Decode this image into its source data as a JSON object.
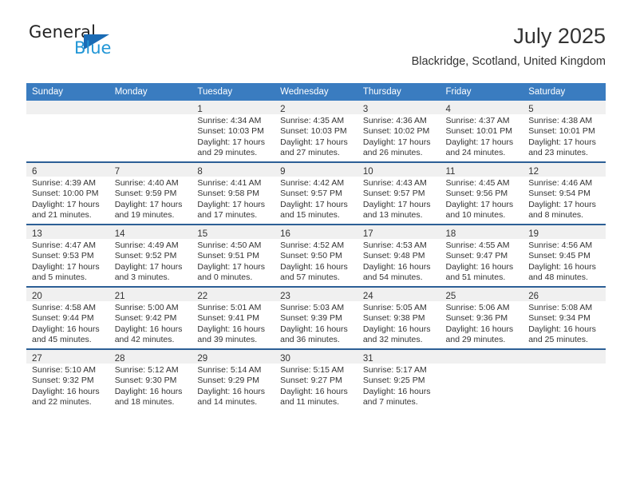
{
  "brand": {
    "name_top": "General",
    "name_bottom": "Blue",
    "triangle_icon": "triangle-icon",
    "colors": {
      "blue": "#1a6bb5",
      "light_blue": "#2196d6",
      "text": "#222222"
    }
  },
  "header": {
    "title": "July 2025",
    "location": "Blackridge, Scotland, United Kingdom"
  },
  "calendar": {
    "header_bg": "#3a7cc0",
    "row_divider": "#2c5f96",
    "daynum_bg": "#f0f0f0",
    "weekdays": [
      "Sunday",
      "Monday",
      "Tuesday",
      "Wednesday",
      "Thursday",
      "Friday",
      "Saturday"
    ],
    "weeks": [
      [
        {
          "day": "",
          "lines": []
        },
        {
          "day": "",
          "lines": []
        },
        {
          "day": "1",
          "lines": [
            "Sunrise: 4:34 AM",
            "Sunset: 10:03 PM",
            "Daylight: 17 hours",
            "and 29 minutes."
          ]
        },
        {
          "day": "2",
          "lines": [
            "Sunrise: 4:35 AM",
            "Sunset: 10:03 PM",
            "Daylight: 17 hours",
            "and 27 minutes."
          ]
        },
        {
          "day": "3",
          "lines": [
            "Sunrise: 4:36 AM",
            "Sunset: 10:02 PM",
            "Daylight: 17 hours",
            "and 26 minutes."
          ]
        },
        {
          "day": "4",
          "lines": [
            "Sunrise: 4:37 AM",
            "Sunset: 10:01 PM",
            "Daylight: 17 hours",
            "and 24 minutes."
          ]
        },
        {
          "day": "5",
          "lines": [
            "Sunrise: 4:38 AM",
            "Sunset: 10:01 PM",
            "Daylight: 17 hours",
            "and 23 minutes."
          ]
        }
      ],
      [
        {
          "day": "6",
          "lines": [
            "Sunrise: 4:39 AM",
            "Sunset: 10:00 PM",
            "Daylight: 17 hours",
            "and 21 minutes."
          ]
        },
        {
          "day": "7",
          "lines": [
            "Sunrise: 4:40 AM",
            "Sunset: 9:59 PM",
            "Daylight: 17 hours",
            "and 19 minutes."
          ]
        },
        {
          "day": "8",
          "lines": [
            "Sunrise: 4:41 AM",
            "Sunset: 9:58 PM",
            "Daylight: 17 hours",
            "and 17 minutes."
          ]
        },
        {
          "day": "9",
          "lines": [
            "Sunrise: 4:42 AM",
            "Sunset: 9:57 PM",
            "Daylight: 17 hours",
            "and 15 minutes."
          ]
        },
        {
          "day": "10",
          "lines": [
            "Sunrise: 4:43 AM",
            "Sunset: 9:57 PM",
            "Daylight: 17 hours",
            "and 13 minutes."
          ]
        },
        {
          "day": "11",
          "lines": [
            "Sunrise: 4:45 AM",
            "Sunset: 9:56 PM",
            "Daylight: 17 hours",
            "and 10 minutes."
          ]
        },
        {
          "day": "12",
          "lines": [
            "Sunrise: 4:46 AM",
            "Sunset: 9:54 PM",
            "Daylight: 17 hours",
            "and 8 minutes."
          ]
        }
      ],
      [
        {
          "day": "13",
          "lines": [
            "Sunrise: 4:47 AM",
            "Sunset: 9:53 PM",
            "Daylight: 17 hours",
            "and 5 minutes."
          ]
        },
        {
          "day": "14",
          "lines": [
            "Sunrise: 4:49 AM",
            "Sunset: 9:52 PM",
            "Daylight: 17 hours",
            "and 3 minutes."
          ]
        },
        {
          "day": "15",
          "lines": [
            "Sunrise: 4:50 AM",
            "Sunset: 9:51 PM",
            "Daylight: 17 hours",
            "and 0 minutes."
          ]
        },
        {
          "day": "16",
          "lines": [
            "Sunrise: 4:52 AM",
            "Sunset: 9:50 PM",
            "Daylight: 16 hours",
            "and 57 minutes."
          ]
        },
        {
          "day": "17",
          "lines": [
            "Sunrise: 4:53 AM",
            "Sunset: 9:48 PM",
            "Daylight: 16 hours",
            "and 54 minutes."
          ]
        },
        {
          "day": "18",
          "lines": [
            "Sunrise: 4:55 AM",
            "Sunset: 9:47 PM",
            "Daylight: 16 hours",
            "and 51 minutes."
          ]
        },
        {
          "day": "19",
          "lines": [
            "Sunrise: 4:56 AM",
            "Sunset: 9:45 PM",
            "Daylight: 16 hours",
            "and 48 minutes."
          ]
        }
      ],
      [
        {
          "day": "20",
          "lines": [
            "Sunrise: 4:58 AM",
            "Sunset: 9:44 PM",
            "Daylight: 16 hours",
            "and 45 minutes."
          ]
        },
        {
          "day": "21",
          "lines": [
            "Sunrise: 5:00 AM",
            "Sunset: 9:42 PM",
            "Daylight: 16 hours",
            "and 42 minutes."
          ]
        },
        {
          "day": "22",
          "lines": [
            "Sunrise: 5:01 AM",
            "Sunset: 9:41 PM",
            "Daylight: 16 hours",
            "and 39 minutes."
          ]
        },
        {
          "day": "23",
          "lines": [
            "Sunrise: 5:03 AM",
            "Sunset: 9:39 PM",
            "Daylight: 16 hours",
            "and 36 minutes."
          ]
        },
        {
          "day": "24",
          "lines": [
            "Sunrise: 5:05 AM",
            "Sunset: 9:38 PM",
            "Daylight: 16 hours",
            "and 32 minutes."
          ]
        },
        {
          "day": "25",
          "lines": [
            "Sunrise: 5:06 AM",
            "Sunset: 9:36 PM",
            "Daylight: 16 hours",
            "and 29 minutes."
          ]
        },
        {
          "day": "26",
          "lines": [
            "Sunrise: 5:08 AM",
            "Sunset: 9:34 PM",
            "Daylight: 16 hours",
            "and 25 minutes."
          ]
        }
      ],
      [
        {
          "day": "27",
          "lines": [
            "Sunrise: 5:10 AM",
            "Sunset: 9:32 PM",
            "Daylight: 16 hours",
            "and 22 minutes."
          ]
        },
        {
          "day": "28",
          "lines": [
            "Sunrise: 5:12 AM",
            "Sunset: 9:30 PM",
            "Daylight: 16 hours",
            "and 18 minutes."
          ]
        },
        {
          "day": "29",
          "lines": [
            "Sunrise: 5:14 AM",
            "Sunset: 9:29 PM",
            "Daylight: 16 hours",
            "and 14 minutes."
          ]
        },
        {
          "day": "30",
          "lines": [
            "Sunrise: 5:15 AM",
            "Sunset: 9:27 PM",
            "Daylight: 16 hours",
            "and 11 minutes."
          ]
        },
        {
          "day": "31",
          "lines": [
            "Sunrise: 5:17 AM",
            "Sunset: 9:25 PM",
            "Daylight: 16 hours",
            "and 7 minutes."
          ]
        },
        {
          "day": "",
          "lines": []
        },
        {
          "day": "",
          "lines": []
        }
      ]
    ]
  }
}
